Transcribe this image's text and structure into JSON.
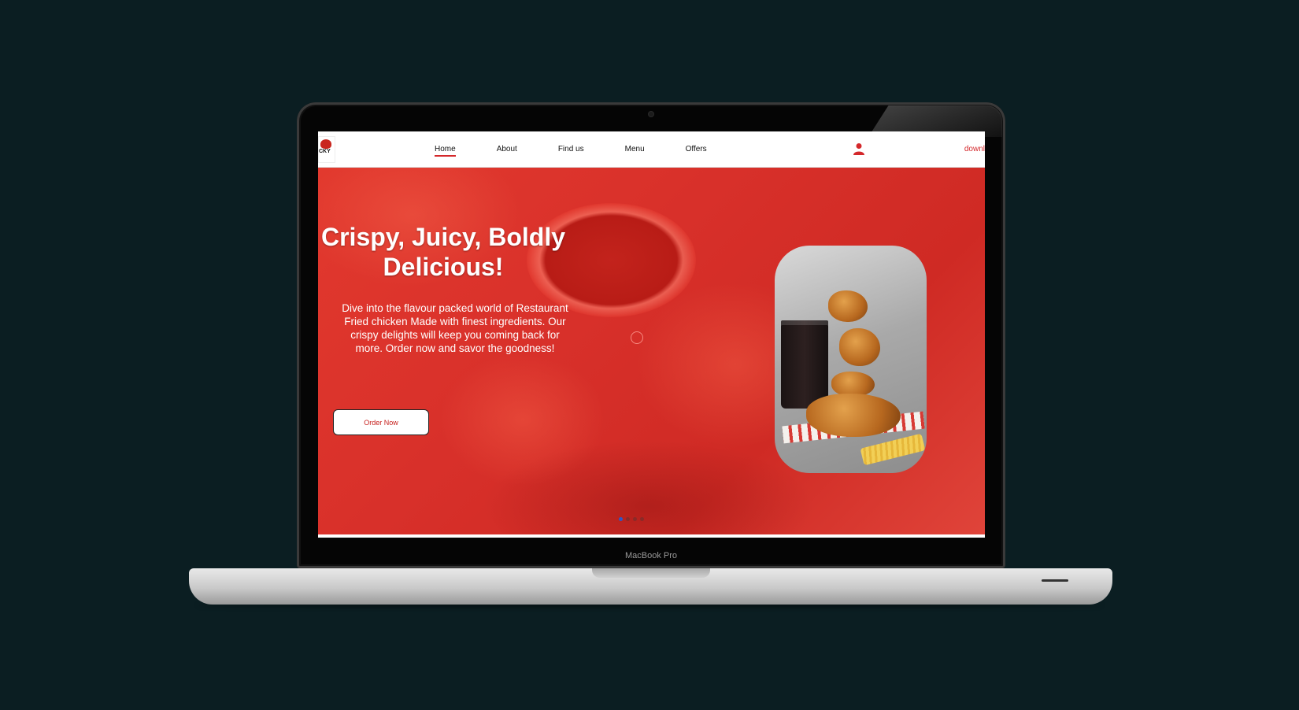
{
  "laptop": {
    "label": "MacBook Pro"
  },
  "nav": {
    "logo_text": "CKY",
    "links": [
      {
        "label": "Home",
        "active": true
      },
      {
        "label": "About",
        "active": false
      },
      {
        "label": "Find us",
        "active": false
      },
      {
        "label": "Menu",
        "active": false
      },
      {
        "label": "Offers",
        "active": false
      }
    ],
    "user_icon": "user-icon",
    "download_label": "downl"
  },
  "hero": {
    "title": "Crispy, Juicy, Boldly Delicious!",
    "description": "Dive into the flavour packed world of Restaurant Fried chicken Made with finest ingredients. Our crispy delights will keep you coming back for more. Order now and savor the goodness!",
    "cta_label": "Order Now",
    "slides_count": 4,
    "active_slide": 1
  },
  "colors": {
    "accent": "#d4282b",
    "background": "#0b1e22",
    "hero_red": "#d8302a",
    "active_dot": "#2e56c6"
  }
}
